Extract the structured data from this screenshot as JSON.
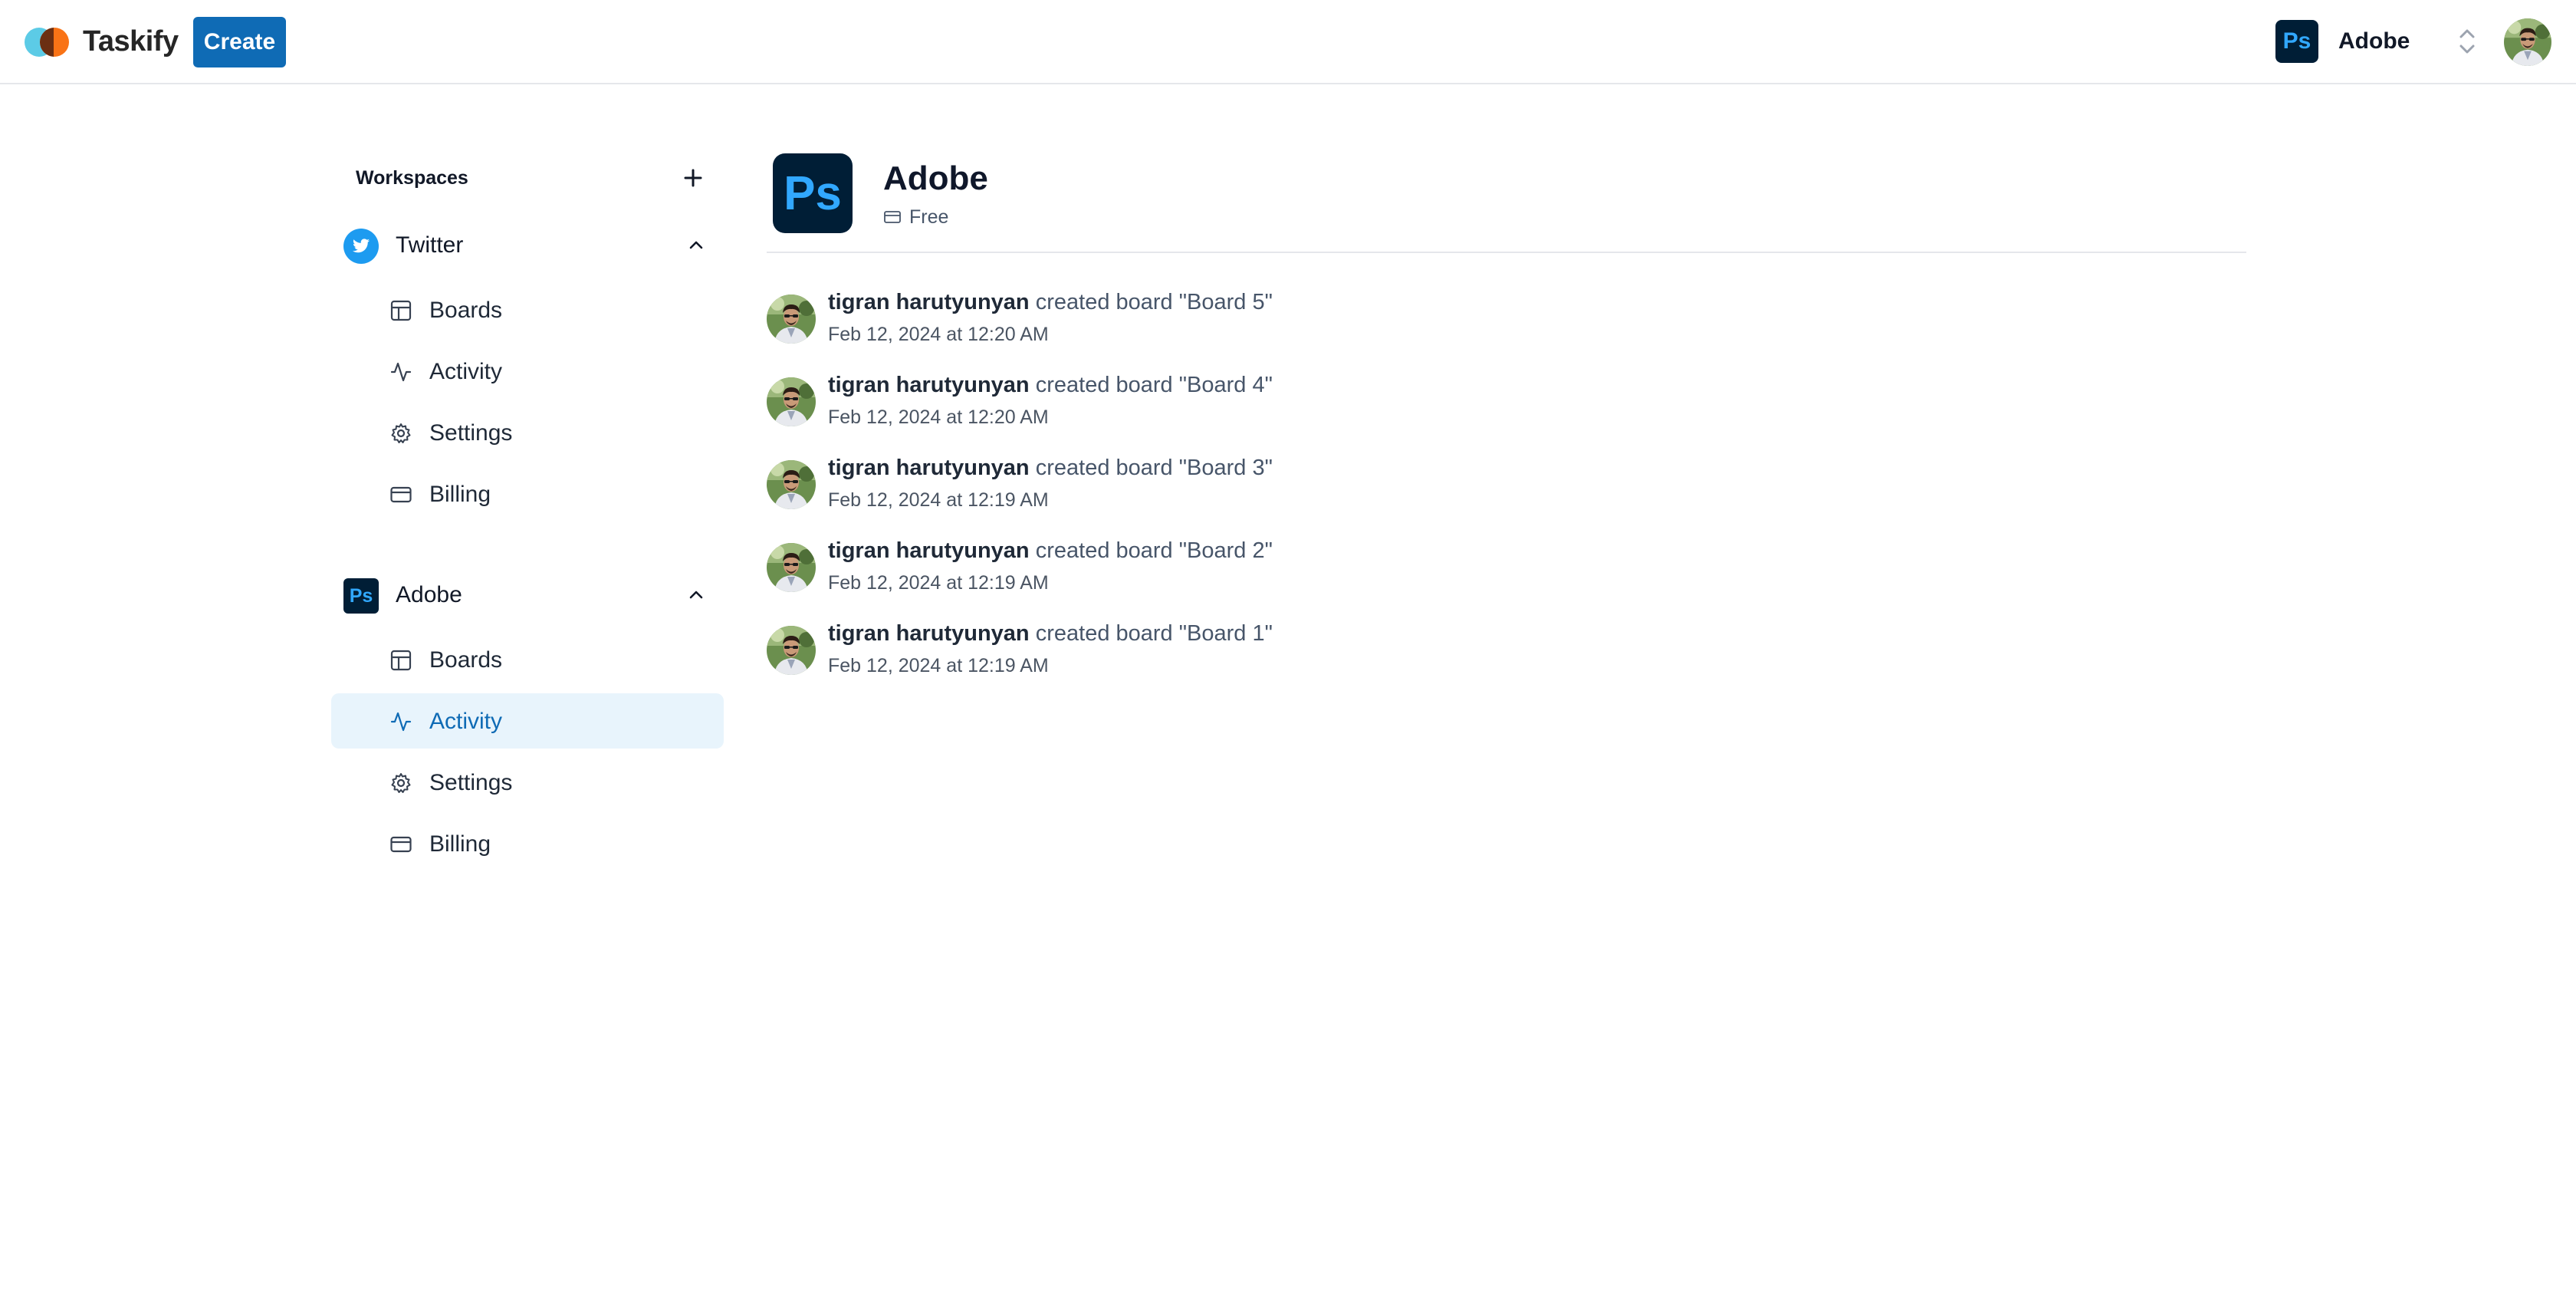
{
  "navbar": {
    "logo_text": "Taskify",
    "create_label": "Create",
    "org_switcher": {
      "name": "Adobe",
      "icon_text": "Ps"
    }
  },
  "sidebar": {
    "header": "Workspaces",
    "workspaces": [
      {
        "name": "Twitter",
        "icon": "twitter-bird-icon",
        "items": [
          {
            "label": "Boards",
            "icon": "layout-icon"
          },
          {
            "label": "Activity",
            "icon": "activity-icon"
          },
          {
            "label": "Settings",
            "icon": "gear-icon"
          },
          {
            "label": "Billing",
            "icon": "credit-card-icon"
          }
        ]
      },
      {
        "name": "Adobe",
        "icon_text": "Ps",
        "items": [
          {
            "label": "Boards",
            "icon": "layout-icon"
          },
          {
            "label": "Activity",
            "icon": "activity-icon",
            "active": true
          },
          {
            "label": "Settings",
            "icon": "gear-icon"
          },
          {
            "label": "Billing",
            "icon": "credit-card-icon"
          }
        ]
      }
    ]
  },
  "org": {
    "name": "Adobe",
    "logo_text": "Ps",
    "plan": "Free"
  },
  "activity": [
    {
      "user": "tigran harutyunyan",
      "action": "created board \"Board 5\"",
      "time": "Feb 12, 2024 at 12:20 AM"
    },
    {
      "user": "tigran harutyunyan",
      "action": "created board \"Board 4\"",
      "time": "Feb 12, 2024 at 12:20 AM"
    },
    {
      "user": "tigran harutyunyan",
      "action": "created board \"Board 3\"",
      "time": "Feb 12, 2024 at 12:19 AM"
    },
    {
      "user": "tigran harutyunyan",
      "action": "created board \"Board 2\"",
      "time": "Feb 12, 2024 at 12:19 AM"
    },
    {
      "user": "tigran harutyunyan",
      "action": "created board \"Board 1\"",
      "time": "Feb 12, 2024 at 12:19 AM"
    }
  ],
  "colors": {
    "brand": "#0f6bb5",
    "active_bg": "#e8f4fc",
    "ps_bg": "#001e36",
    "ps_fg": "#31a8ff",
    "twitter": "#1d9bf0"
  }
}
